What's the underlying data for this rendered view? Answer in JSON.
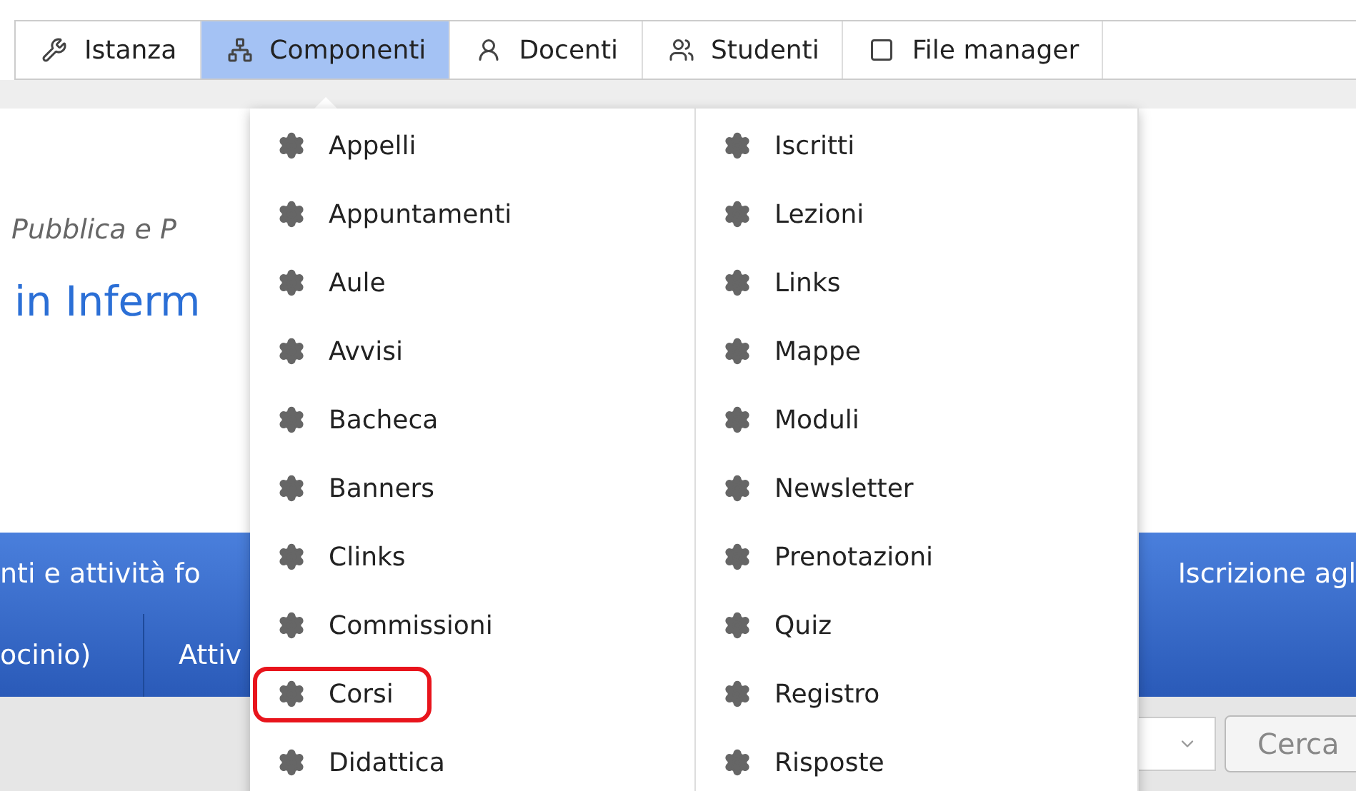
{
  "toolbar": {
    "tabs": [
      {
        "label": "Istanza",
        "selected": false
      },
      {
        "label": "Componenti",
        "selected": true
      },
      {
        "label": "Docenti",
        "selected": false
      },
      {
        "label": "Studenti",
        "selected": false
      },
      {
        "label": "File manager",
        "selected": false
      }
    ]
  },
  "page": {
    "subtitle": "Pubblica e P",
    "heading": "in Inferm",
    "nav_rows": [
      [
        "nti e attività fo",
        "Iscrizione agl"
      ],
      [
        "ocinio)",
        "Attiv"
      ]
    ],
    "search_button": "Cerca"
  },
  "menu": {
    "columns": [
      [
        {
          "label": "Appelli",
          "highlighted": false
        },
        {
          "label": "Appuntamenti",
          "highlighted": false
        },
        {
          "label": "Aule",
          "highlighted": false
        },
        {
          "label": "Avvisi",
          "highlighted": false
        },
        {
          "label": "Bacheca",
          "highlighted": false
        },
        {
          "label": "Banners",
          "highlighted": false
        },
        {
          "label": "Clinks",
          "highlighted": false
        },
        {
          "label": "Commissioni",
          "highlighted": false
        },
        {
          "label": "Corsi",
          "highlighted": true
        },
        {
          "label": "Didattica",
          "highlighted": false
        }
      ],
      [
        {
          "label": "Iscritti",
          "highlighted": false
        },
        {
          "label": "Lezioni",
          "highlighted": false
        },
        {
          "label": "Links",
          "highlighted": false
        },
        {
          "label": "Mappe",
          "highlighted": false
        },
        {
          "label": "Moduli",
          "highlighted": false
        },
        {
          "label": "Newsletter",
          "highlighted": false
        },
        {
          "label": "Prenotazioni",
          "highlighted": false
        },
        {
          "label": "Quiz",
          "highlighted": false
        },
        {
          "label": "Registro",
          "highlighted": false
        },
        {
          "label": "Risposte",
          "highlighted": false
        }
      ]
    ]
  }
}
